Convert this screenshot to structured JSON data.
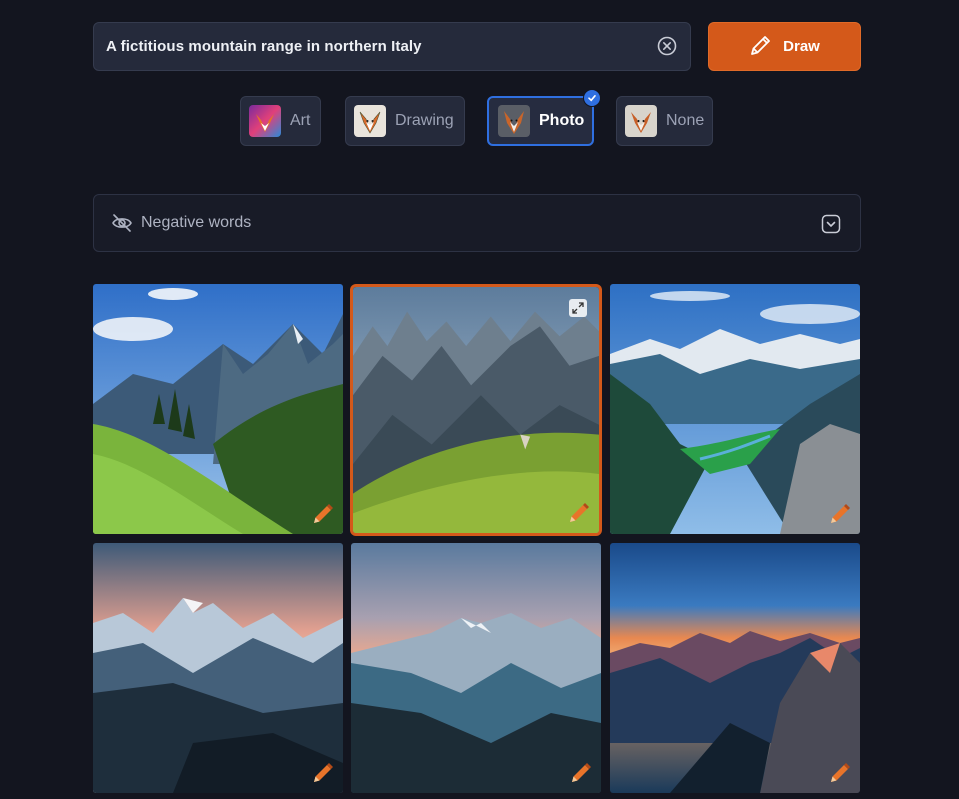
{
  "prompt": {
    "value": "A fictitious mountain range in northern Italy",
    "clear_icon": "close-circle-icon"
  },
  "draw_button": {
    "label": "Draw",
    "icon": "pencil-icon",
    "color": "#d4591a"
  },
  "styles": [
    {
      "label": "Art",
      "selected": false
    },
    {
      "label": "Drawing",
      "selected": false
    },
    {
      "label": "Photo",
      "selected": true
    },
    {
      "label": "None",
      "selected": false
    }
  ],
  "negative_words": {
    "label": "Negative words",
    "icon": "eye-off-icon",
    "toggle_icon": "chevron-down-icon"
  },
  "results": [
    {
      "scene": "green alpine slope with pine trees and sunny peaks",
      "selected": false
    },
    {
      "scene": "jagged dolomite peaks over green meadow",
      "selected": true
    },
    {
      "scene": "deep green valley with river and snowy ridges",
      "selected": false
    },
    {
      "scene": "pink dusk sky over snowy peaks",
      "selected": false
    },
    {
      "scene": "hazy blue mountain ridges at sunset",
      "selected": false
    },
    {
      "scene": "orange sunset glow on rocky peaks",
      "selected": false
    }
  ],
  "colors": {
    "background": "#13151f",
    "accent": "#d4591a",
    "selection": "#2f6fe0"
  }
}
